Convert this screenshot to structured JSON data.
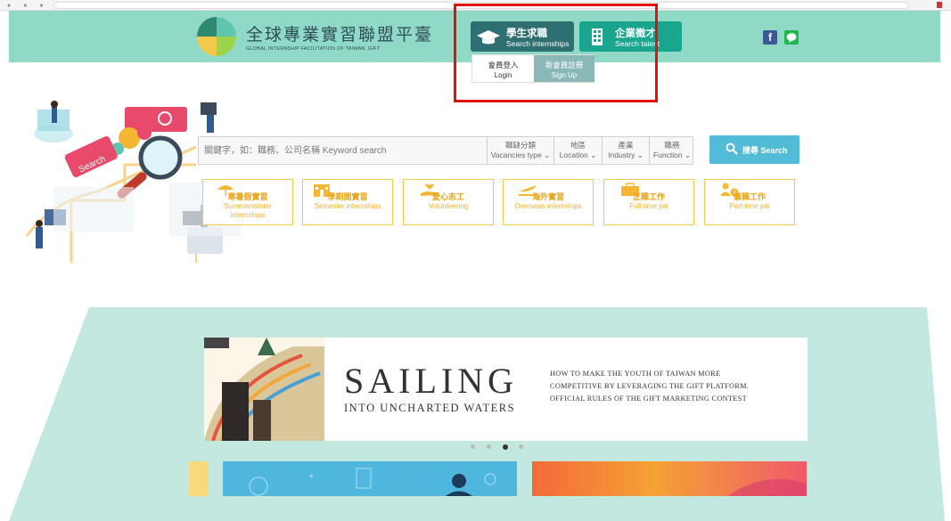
{
  "site": {
    "logo_zh": "全球專業實習聯盟平臺",
    "logo_en": "GLOBAL INTERNSHIP FACILITATION OF TAIWAN, GIFT"
  },
  "nav": {
    "student": {
      "zh": "學生求職",
      "en": "Search internships",
      "icon": "graduation-cap-icon"
    },
    "company": {
      "zh": "企業徵才",
      "en": "Search talent",
      "icon": "building-icon"
    }
  },
  "social": {
    "facebook": "f",
    "line": "line-icon"
  },
  "dropdown": {
    "login": {
      "zh": "會員登入",
      "en": "Login"
    },
    "signup": {
      "zh": "新會員註冊",
      "en": "Sign Up"
    }
  },
  "illustration": {
    "search_tag": "Search"
  },
  "search": {
    "placeholder": "關鍵字，如：職務、公司名稱 Keyword search",
    "filters": [
      {
        "zh": "職缺分類",
        "en": "Vacancies type ⌄"
      },
      {
        "zh": "地區",
        "en": "Location ⌄"
      },
      {
        "zh": "產業",
        "en": "Industry ⌄"
      },
      {
        "zh": "職務",
        "en": "Function ⌄"
      }
    ],
    "button": "搜尋 Search"
  },
  "categories": [
    {
      "zh": "寒暑假實習",
      "en": "Summer/winter internships",
      "icon": "umbrella-icon"
    },
    {
      "zh": "學期間實習",
      "en": "Semester internships",
      "icon": "school-icon"
    },
    {
      "zh": "愛心志工",
      "en": "Volunteering",
      "icon": "heart-hand-icon"
    },
    {
      "zh": "海外實習",
      "en": "Overseas internships",
      "icon": "airplane-icon"
    },
    {
      "zh": "正職工作",
      "en": "Full-time job",
      "icon": "briefcase-icon"
    },
    {
      "zh": "兼職工作",
      "en": "Part-time job",
      "icon": "person-clock-icon"
    }
  ],
  "banner": {
    "title": "SAILING",
    "subtitle": "INTO UNCHARTED WATERS",
    "lines": [
      "HOW TO MAKE THE YOUTH OF TAIWAN MORE",
      "COMPETITIVE BY LEVERAGING THE GIFT PLATFORM.",
      "OFFICIAL RULES OF THE GIFT MARKETING CONTEST"
    ]
  },
  "carousel": {
    "count": 4,
    "active": 3
  },
  "colors": {
    "header_bg": "#8fd9c6",
    "student_btn": "#2e6f72",
    "company_btn": "#1aa58f",
    "search_btn": "#52bbd6",
    "category_accent": "#e8a317",
    "highlight": "#e40f0f",
    "arch_bg": "#c3e8df"
  }
}
